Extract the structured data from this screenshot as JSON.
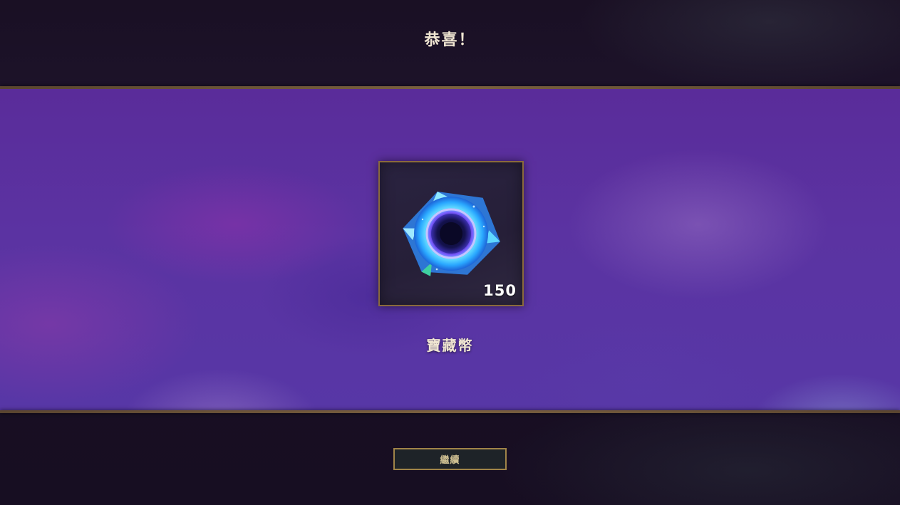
{
  "header": {
    "title": "恭喜！"
  },
  "reward": {
    "icon": "treasure-token-orb-icon",
    "count": "150",
    "name": "寶藏幣"
  },
  "footer": {
    "continue_label": "繼續"
  },
  "colors": {
    "gold_accent": "#8a6a3c",
    "title_text": "#f0e6d2",
    "button_text": "#cdbe91",
    "button_bg": "#1e2328",
    "band_purple": "#5a2c9a"
  }
}
